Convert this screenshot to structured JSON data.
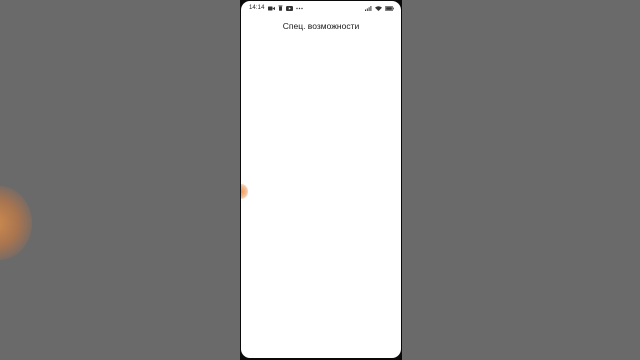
{
  "status_bar": {
    "time": "14:14",
    "left_icons": [
      "video-call-icon",
      "trash-icon",
      "youtube-icon",
      "more-dots-icon"
    ],
    "right_icons": [
      "signal-icon",
      "wifi-icon",
      "battery-icon"
    ]
  },
  "screen": {
    "title": "Спец. возможности"
  },
  "colors": {
    "background": "#686868",
    "screen": "#ffffff",
    "touch_indicator": "#e8945a"
  }
}
